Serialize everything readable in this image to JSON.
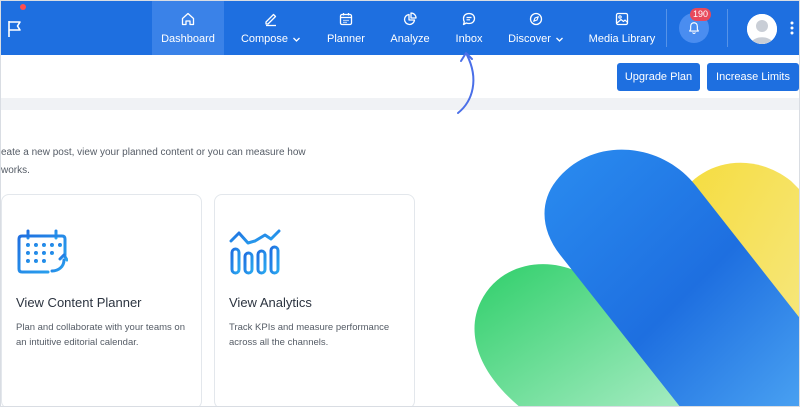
{
  "nav": {
    "items": [
      {
        "label": "Dashboard",
        "icon": "home-icon",
        "active": true
      },
      {
        "label": "Compose",
        "icon": "pen-icon",
        "dropdown": true
      },
      {
        "label": "Planner",
        "icon": "calendar-icon"
      },
      {
        "label": "Analyze",
        "icon": "pie-chart-icon"
      },
      {
        "label": "Inbox",
        "icon": "chat-icon"
      },
      {
        "label": "Discover",
        "icon": "compass-icon",
        "dropdown": true
      },
      {
        "label": "Media Library",
        "icon": "image-icon"
      }
    ],
    "notifications_count": "190",
    "colors": {
      "bar": "#1e6fe0",
      "active": "#3a82e8",
      "badge": "#e8495b"
    }
  },
  "toolbar": {
    "upgrade_label": "Upgrade Plan",
    "increase_label": "Increase Limits"
  },
  "intro": {
    "line1": "eate a new post, view your planned content or you can measure how",
    "line2": "works."
  },
  "cards": [
    {
      "title": "View Content Planner",
      "description": "Plan and collaborate with your teams on an intuitive editorial calendar.",
      "icon": "calendar-grid-icon"
    },
    {
      "title": "View Analytics",
      "description": "Track KPIs and measure performance across all the channels.",
      "icon": "analytics-bars-icon"
    }
  ]
}
